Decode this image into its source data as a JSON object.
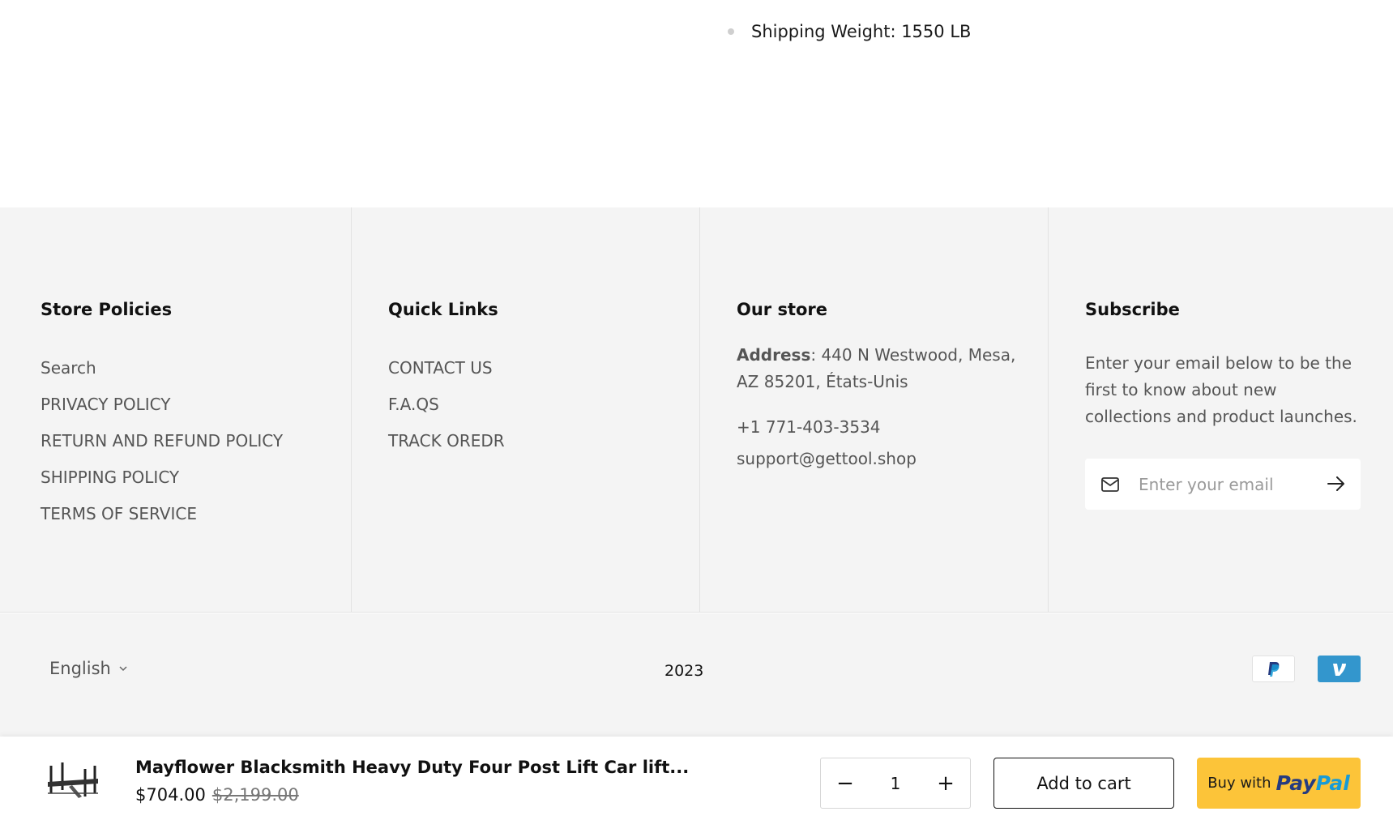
{
  "specs": {
    "partial_line": "· · · · · · · · · · · · · · · · · · · · · · · · · · ·",
    "shipping_weight": "Shipping Weight: 1550 LB"
  },
  "footer": {
    "store_policies": {
      "title": "Store Policies",
      "links": [
        "Search",
        "PRIVACY POLICY",
        "RETURN AND REFUND POLICY",
        "SHIPPING POLICY",
        "TERMS OF SERVICE"
      ]
    },
    "quick_links": {
      "title": "Quick Links",
      "links": [
        "CONTACT US",
        "F.A.QS",
        "TRACK OREDR"
      ]
    },
    "our_store": {
      "title": "Our store",
      "address_label": "Address",
      "address_value": ": 440 N Westwood, Mesa, AZ 85201, États-Unis",
      "phone": "+1 771-403-3534",
      "email": "support@gettool.shop"
    },
    "subscribe": {
      "title": "Subscribe",
      "text": "Enter your email below to be the first to know about new collections and product launches.",
      "placeholder": "Enter your email"
    }
  },
  "bottom": {
    "language": "English",
    "year": "2023",
    "payment_icons": [
      "paypal-icon",
      "venmo-icon"
    ]
  },
  "sticky_cart": {
    "product_title": "Mayflower Blacksmith Heavy Duty Four Post Lift Car lift...",
    "price": "$704.00",
    "compare_price": "$2,199.00",
    "quantity": "1",
    "minus": "−",
    "plus": "+",
    "add_to_cart": "Add to cart",
    "buy_with": "Buy with",
    "paypal_pay": "Pay",
    "paypal_pal": "Pal"
  },
  "colors": {
    "footer_bg": "#f4f4f4",
    "paypal_yellow": "#fcc439",
    "paypal_dark": "#253b80",
    "paypal_light": "#179bd7",
    "venmo_blue": "#3396cd"
  }
}
